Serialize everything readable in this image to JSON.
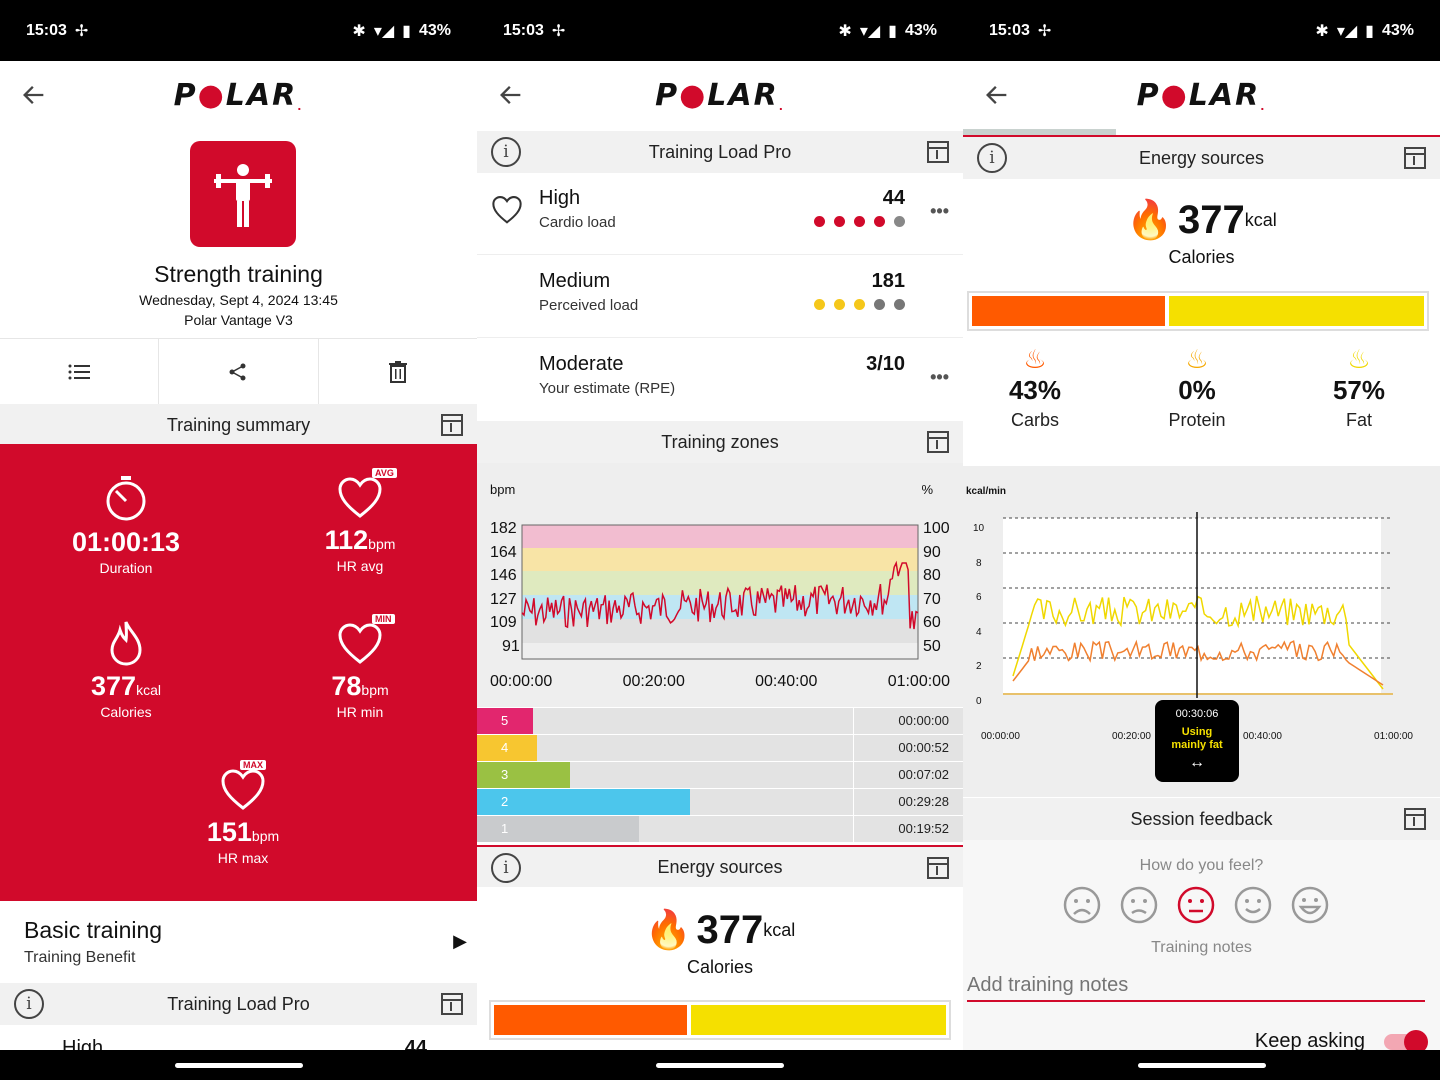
{
  "status": {
    "time": "15:03",
    "battery": "43%"
  },
  "brand": {
    "logo": "POLAR",
    "accent": "#d10a2b"
  },
  "panel1": {
    "sport_name": "Strength training",
    "datetime": "Wednesday, Sept 4, 2024 13:45",
    "device": "Polar Vantage V3",
    "summary_title": "Training summary",
    "stats": {
      "duration": {
        "value": "01:00:13",
        "label": "Duration"
      },
      "hr_avg": {
        "value": "112",
        "unit": "bpm",
        "label": "HR avg",
        "badge": "AVG"
      },
      "calories": {
        "value": "377",
        "unit": "kcal",
        "label": "Calories"
      },
      "hr_min": {
        "value": "78",
        "unit": "bpm",
        "label": "HR min",
        "badge": "MIN"
      },
      "hr_max": {
        "value": "151",
        "unit": "bpm",
        "label": "HR max",
        "badge": "MAX"
      }
    },
    "benefit": {
      "title": "Basic training",
      "subtitle": "Training Benefit"
    },
    "load_title": "Training Load Pro",
    "peek": {
      "label": "High",
      "value": "44"
    }
  },
  "panel2": {
    "load_title": "Training Load Pro",
    "loads": [
      {
        "title": "High",
        "subtitle": "Cardio load",
        "value": "44"
      },
      {
        "title": "Medium",
        "subtitle": "Perceived load",
        "value": "181"
      },
      {
        "title": "Moderate",
        "subtitle": "Your estimate (RPE)",
        "value": "3/10"
      }
    ],
    "zones_title": "Training zones",
    "zone_chart": {
      "left_unit": "bpm",
      "right_unit": "%",
      "left_ticks": [
        "182",
        "164",
        "146",
        "127",
        "109",
        "91"
      ],
      "right_ticks": [
        "100",
        "90",
        "80",
        "70",
        "60",
        "50"
      ],
      "x_ticks": [
        "00:00:00",
        "00:20:00",
        "00:40:00",
        "01:00:00"
      ]
    },
    "zones": [
      {
        "zone": "5",
        "time": "00:00:00",
        "color": "#e2266e",
        "fraction": 0.0
      },
      {
        "zone": "4",
        "time": "00:00:52",
        "color": "#f7c630",
        "fraction": 0.014
      },
      {
        "zone": "3",
        "time": "00:07:02",
        "color": "#9ac143",
        "fraction": 0.117
      },
      {
        "zone": "2",
        "time": "00:29:28",
        "color": "#4cc6ec",
        "fraction": 0.49
      },
      {
        "zone": "1",
        "time": "00:19:52",
        "color": "#c9cbcd",
        "fraction": 0.33
      }
    ],
    "energy_title": "Energy sources",
    "calories": {
      "value": "377",
      "unit": "kcal",
      "label": "Calories"
    }
  },
  "panel3": {
    "energy_title": "Energy sources",
    "calories": {
      "value": "377",
      "unit": "kcal",
      "label": "Calories"
    },
    "energy_split": {
      "carbs": 0.43,
      "protein": 0.0,
      "fat": 0.57
    },
    "macros": [
      {
        "pct": "43%",
        "name": "Carbs"
      },
      {
        "pct": "0%",
        "name": "Protein"
      },
      {
        "pct": "57%",
        "name": "Fat"
      }
    ],
    "kcal_chart": {
      "unit": "kcal/min",
      "y_ticks": [
        "10",
        "8",
        "6",
        "4",
        "2",
        "0"
      ],
      "x_ticks": [
        "00:00:00",
        "00:20:00",
        "00:40:00",
        "01:00:00"
      ],
      "tooltip_time": "00:30:06",
      "tooltip_text": "Using mainly fat"
    },
    "feedback_title": "Session feedback",
    "feel_question": "How do you feel?",
    "notes_label": "Training notes",
    "notes_placeholder": "Add training notes",
    "keep_asking": "Keep asking"
  }
}
